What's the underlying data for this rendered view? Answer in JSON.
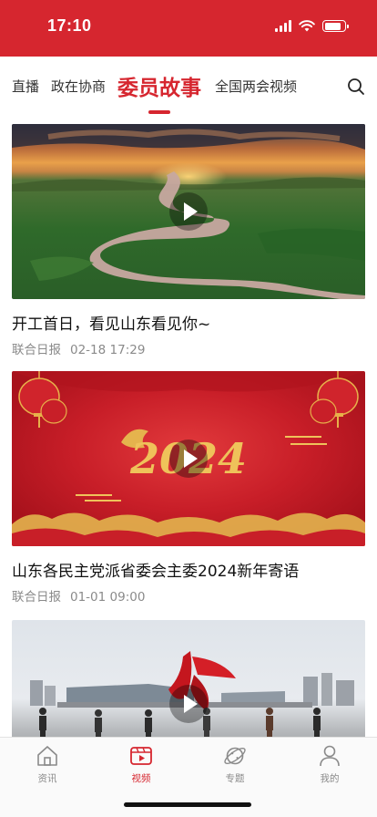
{
  "status_bar": {
    "time": "17:10",
    "battery_level": 0.85
  },
  "tabs": [
    {
      "label": "直播",
      "active": false
    },
    {
      "label": "政在协商",
      "active": false
    },
    {
      "label": "委员故事",
      "active": true
    },
    {
      "label": "全国两会视频",
      "active": false
    }
  ],
  "search": {
    "icon": "search-icon"
  },
  "feed": [
    {
      "title": "开工首日，看见山东看见你~",
      "source": "联合日报",
      "time": "02-18 17:29"
    },
    {
      "title": "山东各民主党派省委会主委2024新年寄语",
      "source": "联合日报",
      "time": "01-01 09:00",
      "thumb_text": "2024"
    },
    {
      "title": "",
      "source": "",
      "time": ""
    }
  ],
  "tabbar": [
    {
      "label": "资讯",
      "icon": "home-icon",
      "active": false
    },
    {
      "label": "视频",
      "icon": "video-play-icon",
      "active": true
    },
    {
      "label": "专题",
      "icon": "planet-icon",
      "active": false
    },
    {
      "label": "我的",
      "icon": "user-icon",
      "active": false
    }
  ],
  "colors": {
    "brand_red": "#d6262f",
    "inactive_gray": "#8a8a8a"
  }
}
